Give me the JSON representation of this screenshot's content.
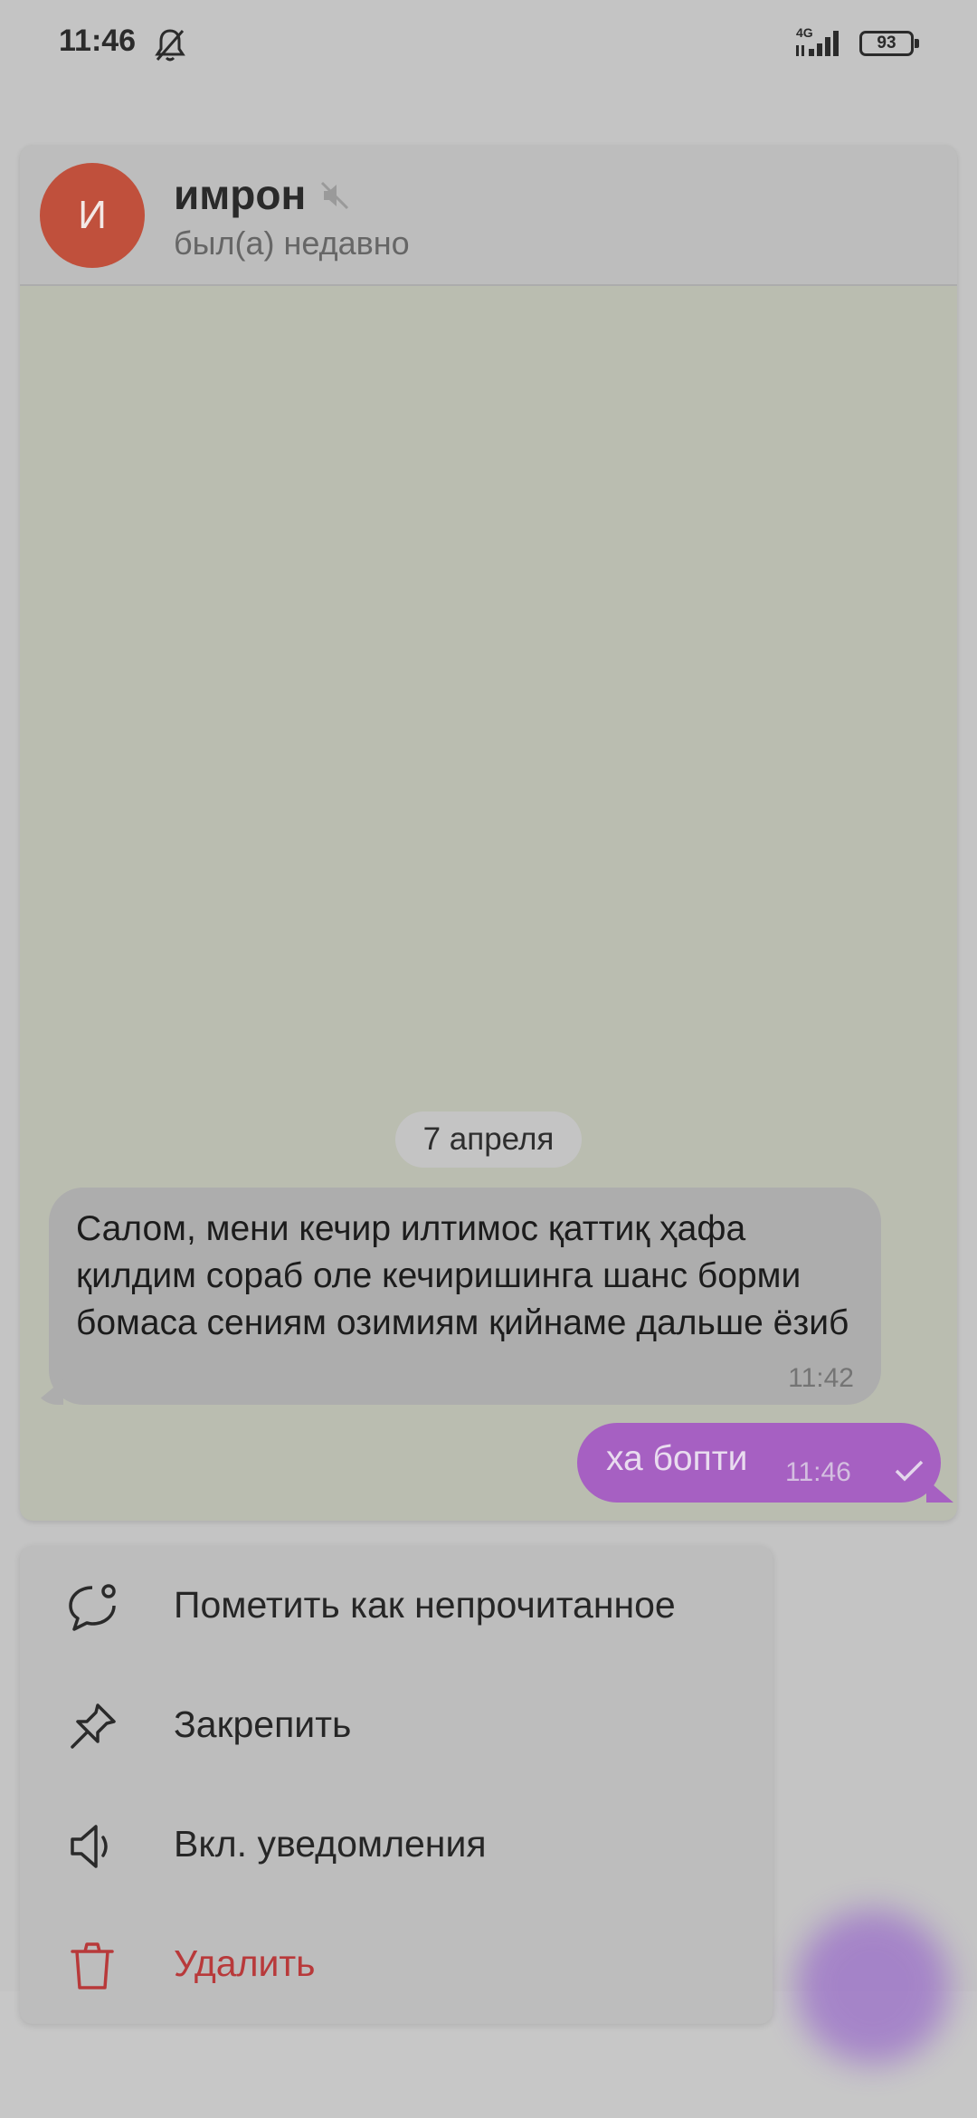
{
  "status_bar": {
    "time": "11:46",
    "network": "4G",
    "battery": "93"
  },
  "chat": {
    "avatar_letter": "И",
    "contact_name": "имрон",
    "contact_status": "был(а) недавно",
    "date_separator": "7 апреля",
    "messages": [
      {
        "direction": "incoming",
        "text": "Салом, мени кечир илтимос қаттиқ ҳафа қилдим сораб оле кечиришинга шанс борми бомаса сениям озимиям қийнаме дальше ёзиб",
        "time": "11:42"
      },
      {
        "direction": "outgoing",
        "text": "ха бопти",
        "time": "11:46"
      }
    ]
  },
  "context_menu": {
    "items": [
      {
        "label": "Пометить как непрочитанное",
        "icon": "chat-bubble-dot-icon"
      },
      {
        "label": "Закрепить",
        "icon": "pin-icon"
      },
      {
        "label": "Вкл. уведомления",
        "icon": "speaker-icon"
      },
      {
        "label": "Удалить",
        "icon": "trash-icon",
        "color": "#b8393a"
      }
    ]
  },
  "colors": {
    "avatar": "#c0503c",
    "outgoing_bubble": "#a660c2",
    "danger": "#b8393a"
  }
}
